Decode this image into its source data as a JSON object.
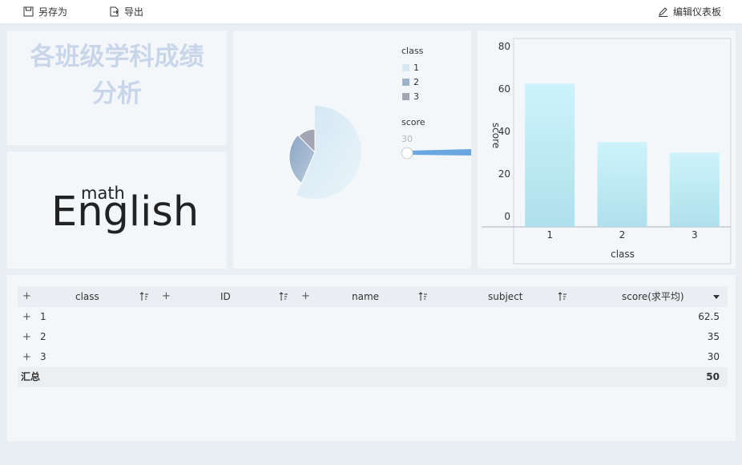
{
  "toolbar": {
    "save_as_label": "另存为",
    "export_label": "导出",
    "edit_dashboard_label": "编辑仪表板"
  },
  "title_panel": {
    "line1": "各班级学科成绩",
    "line2": "分析"
  },
  "word_cloud": {
    "words": [
      "math",
      "English"
    ]
  },
  "pie_panel": {
    "legend_title": "class",
    "legend_items": [
      {
        "label": "1",
        "color": "#d6e8f2"
      },
      {
        "label": "2",
        "color": "#9fb3c9"
      },
      {
        "label": "3",
        "color": "#a3a6b2"
      }
    ],
    "slider_title": "score",
    "slider_value": "30"
  },
  "chart_data": {
    "type": "bar",
    "categories": [
      "1",
      "2",
      "3"
    ],
    "values": [
      62.5,
      35,
      30
    ],
    "xlabel": "class",
    "ylabel": "score",
    "ylim": [
      0,
      80
    ],
    "yticks": [
      "0",
      "20",
      "40",
      "60",
      "80"
    ],
    "grid": false
  },
  "table": {
    "headers": [
      "class",
      "ID",
      "name",
      "subject",
      "score(求平均)"
    ],
    "rows": [
      {
        "class": "1",
        "score": "62.5"
      },
      {
        "class": "2",
        "score": "35"
      },
      {
        "class": "3",
        "score": "30"
      }
    ],
    "total_label": "汇总",
    "total_value": "50"
  }
}
